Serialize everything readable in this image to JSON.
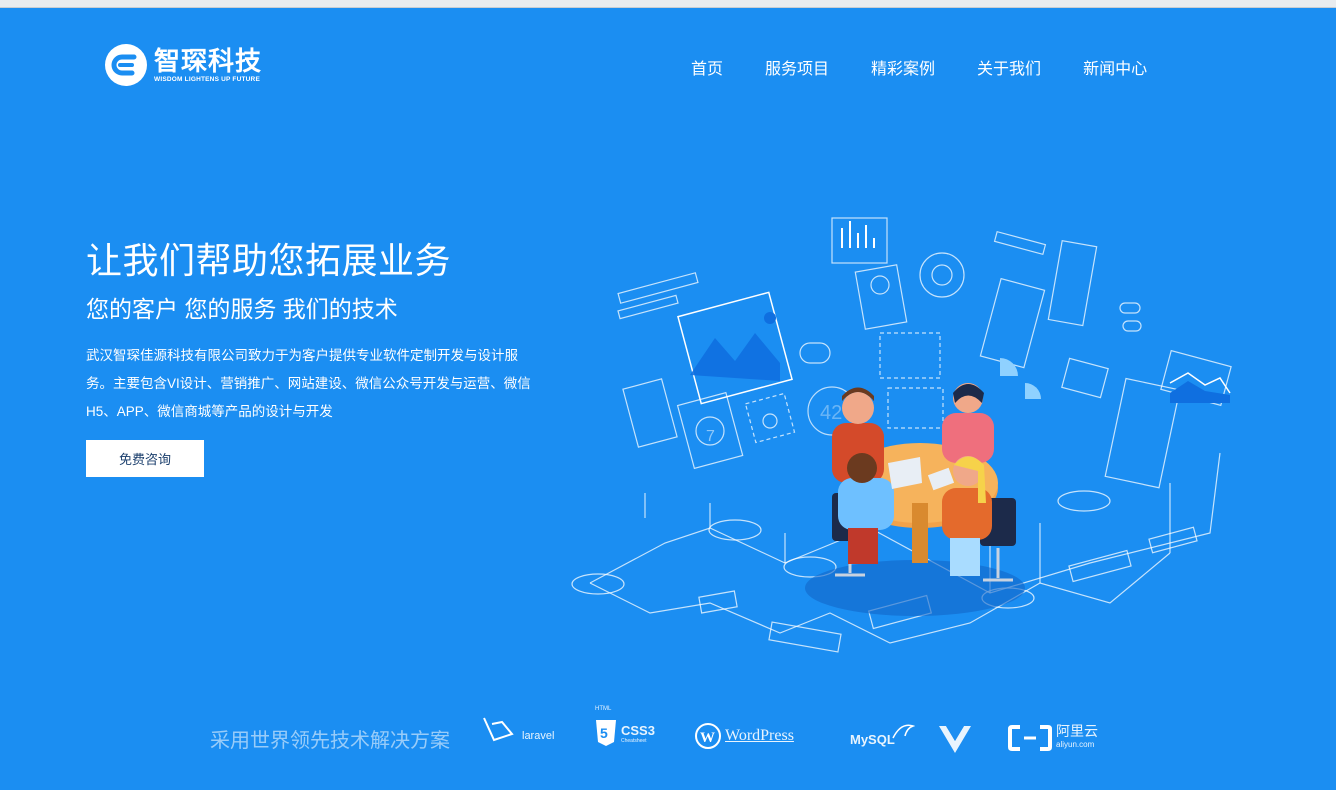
{
  "brand": {
    "name_cn": "智琛科技",
    "tagline_en": "WISDOM LIGHTENS UP FUTURE"
  },
  "nav": {
    "items": [
      {
        "label": "首页"
      },
      {
        "label": "服务项目"
      },
      {
        "label": "精彩案例"
      },
      {
        "label": "关于我们"
      },
      {
        "label": "新闻中心"
      }
    ]
  },
  "hero": {
    "title": "让我们帮助您拓展业务",
    "subtitle": "您的客户 您的服务 我们的技术",
    "description": "武汉智琛佳源科技有限公司致力于为客户提供专业软件定制开发与设计服务。主要包含VI设计、营销推广、网站建设、微信公众号开发与运营、微信H5、APP、微信商城等产品的设计与开发",
    "cta_label": "免费咨询"
  },
  "illustration": {
    "badge_number": "42",
    "round_number": "7"
  },
  "tech": {
    "title": "采用世界领先技术解决方案",
    "logos": {
      "laravel": "laravel",
      "css3_top": "HTML",
      "css3": "CSS3",
      "css3_sub": "Cheatsheet",
      "wordpress": "WordPress",
      "mysql": "MySQL",
      "aliyun_cn": "阿里云",
      "aliyun_en": "aliyun.com"
    }
  },
  "colors": {
    "background": "#1b8ef2",
    "cta_text": "#1b3f6d",
    "table": "#f2a24a"
  }
}
